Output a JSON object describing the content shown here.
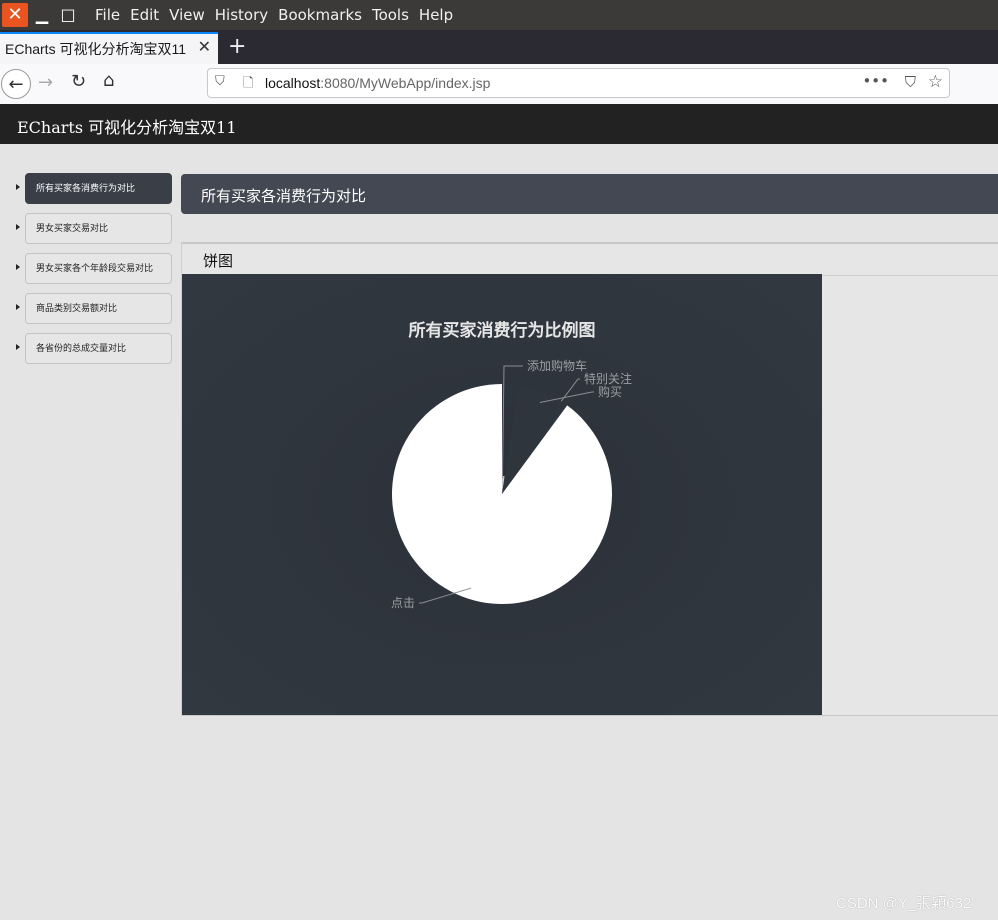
{
  "window": {
    "menu": [
      "File",
      "Edit",
      "View",
      "History",
      "Bookmarks",
      "Tools",
      "Help"
    ]
  },
  "browser": {
    "tab_title": "ECharts 可视化分析淘宝双11",
    "url_host": "localhost",
    "url_rest": ":8080/MyWebApp/index.jsp"
  },
  "app": {
    "title": "ECharts 可视化分析淘宝双11",
    "sidebar": [
      {
        "label": "所有买家各消费行为对比",
        "active": true
      },
      {
        "label": "男女买家交易对比",
        "active": false
      },
      {
        "label": "男女买家各个年龄段交易对比",
        "active": false
      },
      {
        "label": "商品类别交易额对比",
        "active": false
      },
      {
        "label": "各省份的总成交量对比",
        "active": false
      }
    ],
    "panel_title": "所有买家各消费行为对比",
    "card_title": "饼图"
  },
  "chart_data": {
    "type": "pie",
    "title": "所有买家消费行为比例图",
    "labels": [
      "点击",
      "添加购物车",
      "特别关注",
      "购买"
    ],
    "values": [
      89.9,
      0.9,
      1.5,
      7.7
    ],
    "colors": [
      "#ffffff",
      "#cfcfcf",
      "#d8d8d8",
      "#2f353d"
    ]
  },
  "watermark": "CSDN @Y_張穎632"
}
